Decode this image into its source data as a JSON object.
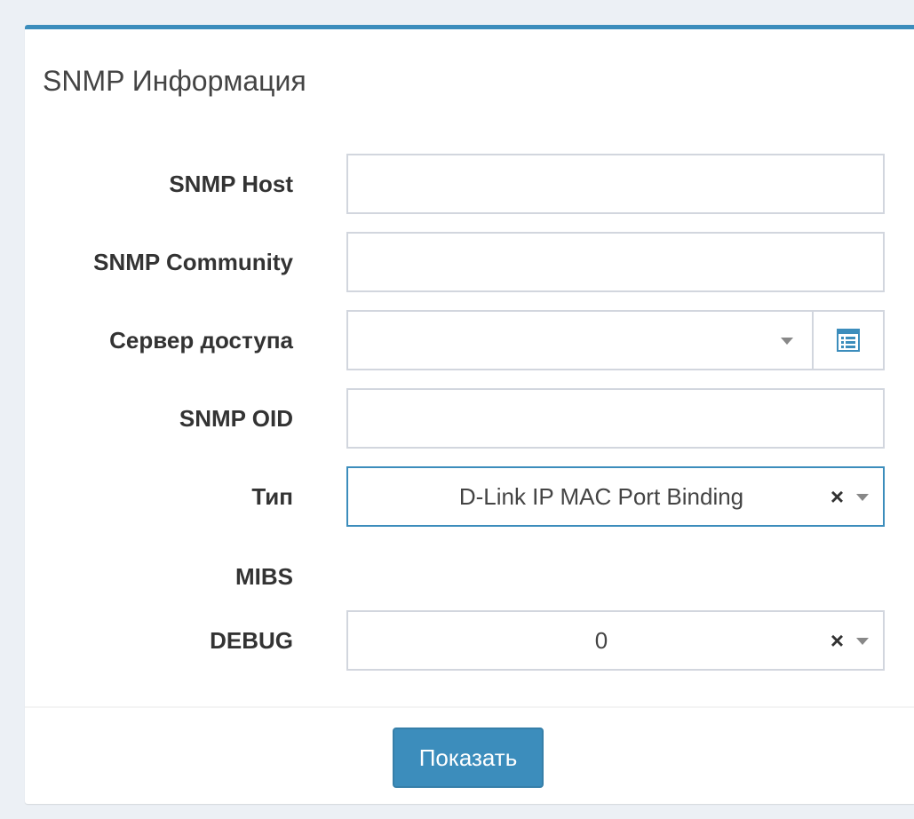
{
  "panel": {
    "title": "SNMP Информация"
  },
  "form": {
    "snmp_host": {
      "label": "SNMP Host",
      "value": ""
    },
    "snmp_community": {
      "label": "SNMP Community",
      "value": ""
    },
    "access_server": {
      "label": "Сервер доступа",
      "value": "",
      "addon_icon": "list-icon"
    },
    "snmp_oid": {
      "label": "SNMP OID",
      "value": ""
    },
    "type": {
      "label": "Тип",
      "value": "D-Link IP MAC Port Binding",
      "clear": "×"
    },
    "mibs": {
      "label": "MIBS"
    },
    "debug": {
      "label": "DEBUG",
      "value": "0",
      "clear": "×"
    }
  },
  "footer": {
    "show_button": "Показать"
  },
  "colors": {
    "accent": "#3c8dbc",
    "border": "#d2d6de",
    "background": "#ecf0f5"
  }
}
